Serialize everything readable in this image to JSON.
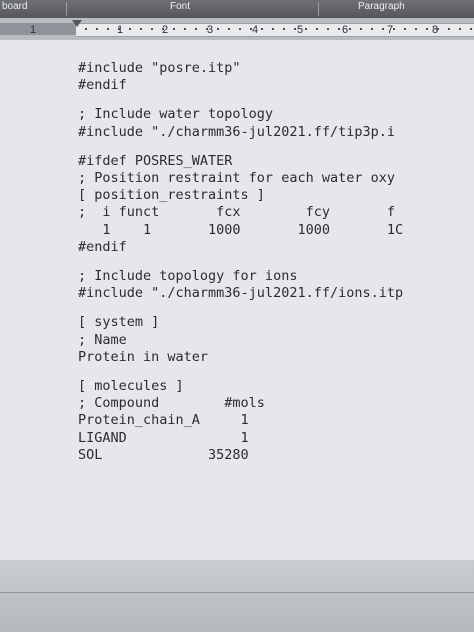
{
  "ribbon": {
    "group_clipboard": "board",
    "group_font": "Font",
    "group_paragraph": "Paragraph"
  },
  "ruler": {
    "numbers": [
      "1",
      "1",
      "2",
      "3",
      "4",
      "5",
      "6",
      "7",
      "8"
    ]
  },
  "document": {
    "lines": [
      "#include \"posre.itp\"",
      "#endif",
      "",
      "; Include water topology",
      "#include \"./charmm36-jul2021.ff/tip3p.i",
      "",
      "#ifdef POSRES_WATER",
      "; Position restraint for each water oxy",
      "[ position_restraints ]",
      ";  i funct       fcx        fcy       f",
      "   1    1       1000       1000       1C",
      "#endif",
      "",
      "; Include topology for ions",
      "#include \"./charmm36-jul2021.ff/ions.itp",
      "",
      "[ system ]",
      "; Name",
      "Protein in water",
      "",
      "[ molecules ]",
      "; Compound        #mols",
      "Protein_chain_A     1",
      "LIGAND              1",
      "SOL             35280"
    ]
  }
}
